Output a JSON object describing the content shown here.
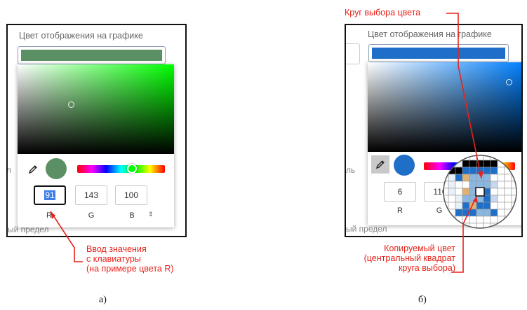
{
  "panel_a": {
    "field_label": "Цвет отображения на графике",
    "field_color": "#5b8f64",
    "behind_text_left": "л",
    "behind_text_bottom": "ый предел",
    "hue_color": "#00ff00",
    "preview_color": "#5b8f64",
    "channels": [
      {
        "label": "R",
        "value": "91",
        "active": true
      },
      {
        "label": "G",
        "value": "143",
        "active": false
      },
      {
        "label": "B",
        "value": "100",
        "active": false
      }
    ],
    "toggle_icon": "sort-arrows-icon",
    "caption": "а)"
  },
  "panel_b": {
    "field_label": "Цвет отображения на графике",
    "field_color": "#1f6fc9",
    "behind_text_left": "ль",
    "behind_text_bottom": "ый предел",
    "hue_color": "#0080ff",
    "preview_color": "#1f6fc9",
    "channels": [
      {
        "label": "R",
        "value": "6"
      },
      {
        "label": "G",
        "value": "110"
      }
    ],
    "caption": "б)"
  },
  "annotations": {
    "keyboard_input": [
      "Ввод значения",
      "с клавиатуры",
      "(на примере цвета R)"
    ],
    "picker_circle": "Круг выбора цвета",
    "copied_color": [
      "Копируемый цвет",
      "(центральный квадрат",
      "круга выбора)"
    ],
    "accent_color": "#e8221a"
  },
  "icons": [
    "eyedropper-icon",
    "sort-arrows-icon",
    "magnifier-loupe"
  ]
}
